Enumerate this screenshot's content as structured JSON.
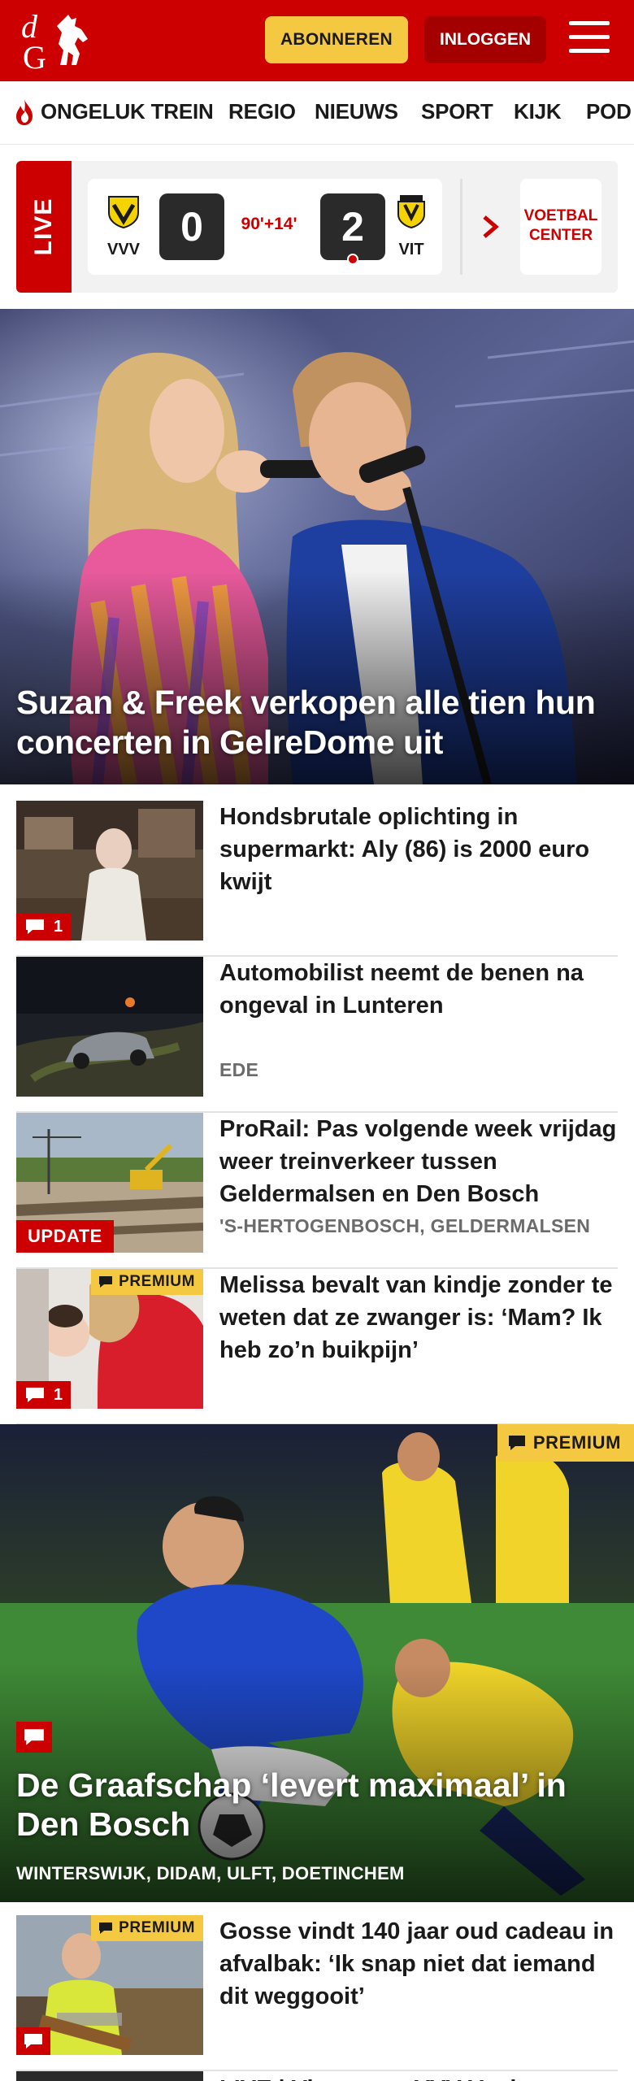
{
  "header": {
    "subscribe_label": "ABONNEREN",
    "login_label": "INLOGGEN",
    "brand_color": "#cc0000",
    "subscribe_color": "#f5c842"
  },
  "nav": {
    "items": [
      "ONGELUK TREIN",
      "REGIO",
      "NIEUWS",
      "SPORT",
      "KIJK",
      "POD"
    ]
  },
  "live": {
    "tab_label": "LIVE",
    "home_team": "VVV",
    "away_team": "VIT",
    "home_score": "0",
    "away_score": "2",
    "match_time": "90'+14'",
    "center_label_1": "VOETBAL",
    "center_label_2": "CENTER"
  },
  "hero": {
    "title": "Suzan & Freek verkopen alle tien hun concerten in GelreDome uit"
  },
  "articles": [
    {
      "title": "Hondsbrutale oplichting in supermarkt: Aly (86) is 2000 euro kwijt",
      "meta": "",
      "comments": "1"
    },
    {
      "title": "Automobilist neemt de benen na ongeval in Lunteren",
      "meta": "EDE"
    },
    {
      "title": "ProRail: Pas volgende week vrijdag weer treinverkeer tussen Geldermalsen en Den Bosch",
      "meta": "'S-HERTOGENBOSCH, GELDERMALSEN",
      "badge": "UPDATE"
    },
    {
      "title": "Melissa bevalt van kindje zonder te weten dat ze zwanger is: ‘Mam? Ik heb zo’n buikpijn’",
      "meta": "",
      "comments": "1",
      "premium": "PREMIUM"
    },
    {
      "title": "Gosse vindt 140 jaar oud cadeau in afvalbak: ‘Ik snap niet dat iemand dit weggooit’",
      "meta": "",
      "premium": "PREMIUM"
    }
  ],
  "feature": {
    "title": "De Graafschap ‘levert maximaal’ in Den Bosch",
    "meta": "WINTERSWIJK, DIDAM, ULFT, DOETINCHEM",
    "premium": "PREMIUM"
  },
  "next_teaser": {
    "title": "LIVE | Vitesse na VVV-Venlo"
  }
}
